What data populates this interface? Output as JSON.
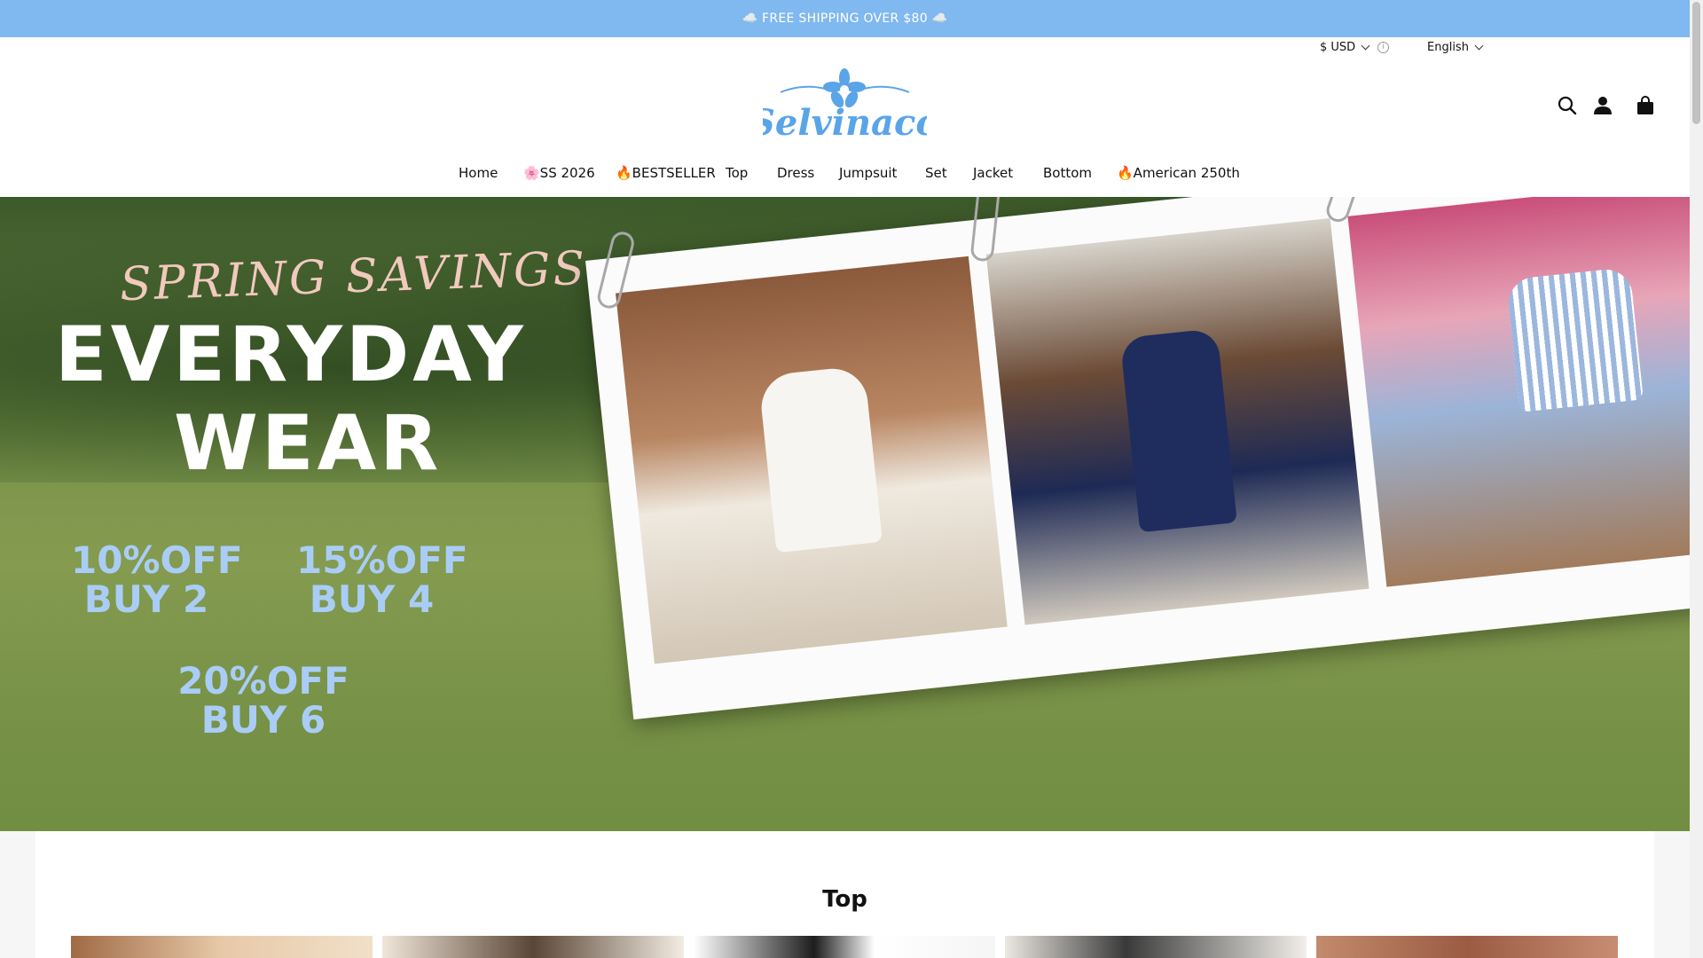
{
  "announcement": {
    "text": "☁️ FREE SHIPPING OVER $80 ☁️"
  },
  "utility": {
    "currency_label": "$ USD",
    "language_label": "English"
  },
  "logo": {
    "text": "Selvinaco"
  },
  "header_icons": [
    "search-icon",
    "account-icon",
    "cart-icon"
  ],
  "nav": {
    "items": [
      {
        "label": "Home"
      },
      {
        "label": "🌸SS 2026"
      },
      {
        "label": "🔥BESTSELLER"
      },
      {
        "label": "Top"
      },
      {
        "label": "Dress"
      },
      {
        "label": "Jumpsuit"
      },
      {
        "label": "Set"
      },
      {
        "label": "Jacket"
      },
      {
        "label": "Bottom"
      },
      {
        "label": "🔥American 250th"
      }
    ]
  },
  "hero": {
    "script_title": "SPRING SAVINGS",
    "line1": "EVERYDAY",
    "line2": "WEAR",
    "offers": [
      {
        "pct": "10%OFF",
        "buy": "BUY 2"
      },
      {
        "pct": "15%OFF",
        "buy": "BUY 4"
      },
      {
        "pct": "20%OFF",
        "buy": "BUY 6"
      }
    ]
  },
  "colors": {
    "announcement_bg": "#80b8f0",
    "logo_blue": "#5aa4e8",
    "offer_blue": "#a9cdf6",
    "script_pink": "#f1c9bd"
  },
  "section": {
    "title": "Top"
  }
}
